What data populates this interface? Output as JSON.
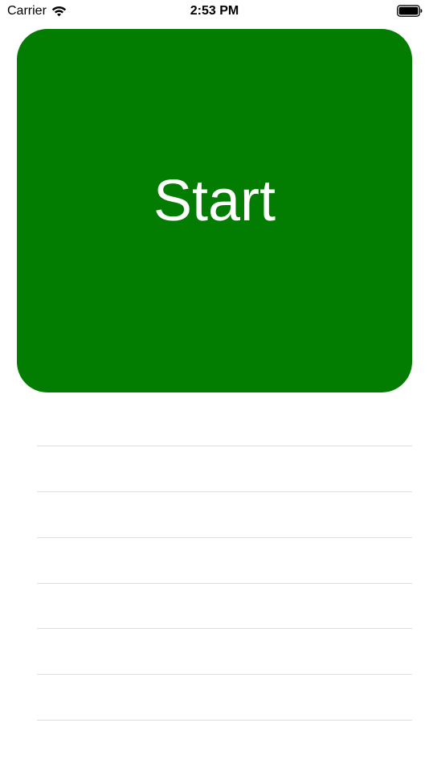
{
  "status_bar": {
    "carrier": "Carrier",
    "time": "2:53 PM",
    "wifi_icon": "wifi-icon",
    "battery_icon": "battery-icon"
  },
  "start_button": {
    "label": "Start",
    "color": "#037c02",
    "text_color": "#ffffff"
  },
  "list": {
    "row_count": 6,
    "rows": [
      "",
      "",
      "",
      "",
      "",
      ""
    ],
    "separator_color": "#dedede"
  }
}
